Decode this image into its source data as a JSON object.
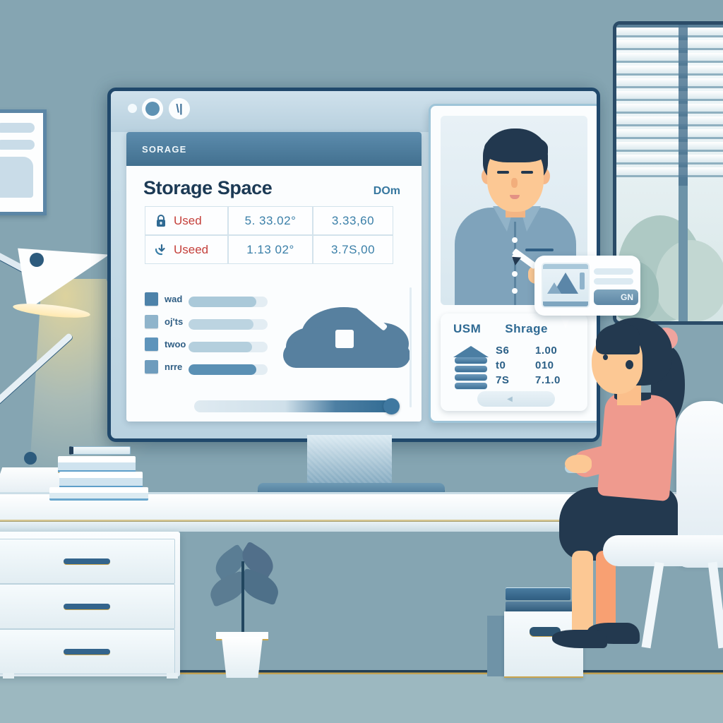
{
  "scene": {
    "title": "Storage Space dashboard on desktop monitor in home office",
    "colors": {
      "wall": "#85a5b2",
      "floor": "#9cb8c0",
      "accent_blue": "#42708f",
      "monitor_bezel": "#20486b",
      "value_blue": "#3a7fa8",
      "used_red": "#c43f3a",
      "skin": "#fcc894",
      "sweater_pink": "#ef9a8e",
      "hair_navy": "#23394f"
    }
  },
  "browser": {
    "window_controls": [
      {
        "name": "control-dot-small",
        "glyph": ""
      },
      {
        "name": "control-dot-filled",
        "glyph": ""
      },
      {
        "name": "control-dot-glyph",
        "glyph": "\\|"
      }
    ]
  },
  "dashboard": {
    "titlebar": "SORAGE",
    "heading": "Storage Space",
    "unit_label": "DOm",
    "table": {
      "rows": [
        {
          "icon": "lock-icon",
          "label": "Used",
          "value_1": "5. 33.02°",
          "value_2": "3.33,60"
        },
        {
          "icon": "download-arrow-icon",
          "label": "Useed",
          "value_1": "1.13 02°",
          "value_2": "3.7S,00"
        }
      ]
    },
    "legend": [
      {
        "label": "wad",
        "color": "#4d82a9",
        "fill_pct": 86
      },
      {
        "label": "oj'ts",
        "color": "#8fb4cb",
        "fill_pct": 82
      },
      {
        "label": "twoo",
        "color": "#5e94bb",
        "fill_pct": 80
      },
      {
        "label": "nrre",
        "color": "#6e9cbd",
        "fill_pct": 86
      }
    ],
    "cloud_icon": "cloud-gauge-icon",
    "slider": {
      "name": "storage-slider",
      "value_pct": 96
    }
  },
  "video_panel": {
    "participant": "male-presenter-avatar",
    "card": {
      "headers": [
        "USM",
        "Shrage"
      ],
      "icon": "server-stack-icon",
      "rows": [
        {
          "left": "S6",
          "right": "1.00"
        },
        {
          "left": "t0",
          "right": "010"
        },
        {
          "left": "7S",
          "right": "7.1.0"
        }
      ],
      "button_label": ""
    }
  },
  "bubble": {
    "thumbnail": "chart-thumbnail-icon",
    "line_1": "",
    "line_2": "",
    "button_label": "GN"
  },
  "room": {
    "wall_art": "framed-picture",
    "window": "window-with-blinds",
    "lamp": "desk-lamp",
    "plant": "potted-plant",
    "books_on_desk": "book-stack",
    "floor_box": "storage-box",
    "chair": "office-chair",
    "person": "woman-at-desk"
  }
}
